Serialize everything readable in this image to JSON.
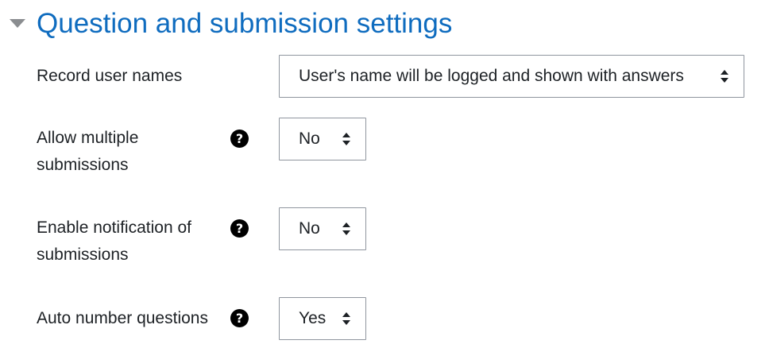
{
  "section": {
    "title": "Question and submission settings",
    "collapse_icon": "caret-down-icon"
  },
  "rows": {
    "record_user_names": {
      "label": "Record user names",
      "value": "User's name will be logged and shown with answers"
    },
    "allow_multiple": {
      "label_line1": "Allow multiple",
      "label_line2": "submissions",
      "help_icon": "question-circle-icon",
      "value": "No"
    },
    "enable_notification": {
      "label_line1": "Enable notification of",
      "label_line2": "submissions",
      "help_icon": "question-circle-icon",
      "value": "No"
    },
    "auto_number": {
      "label": "Auto number questions",
      "help_icon": "question-circle-icon",
      "value": "Yes"
    }
  },
  "colors": {
    "title": "#0f6cbf",
    "text": "#1d2125",
    "border": "#8f959e",
    "caret": "#8a8d90"
  }
}
